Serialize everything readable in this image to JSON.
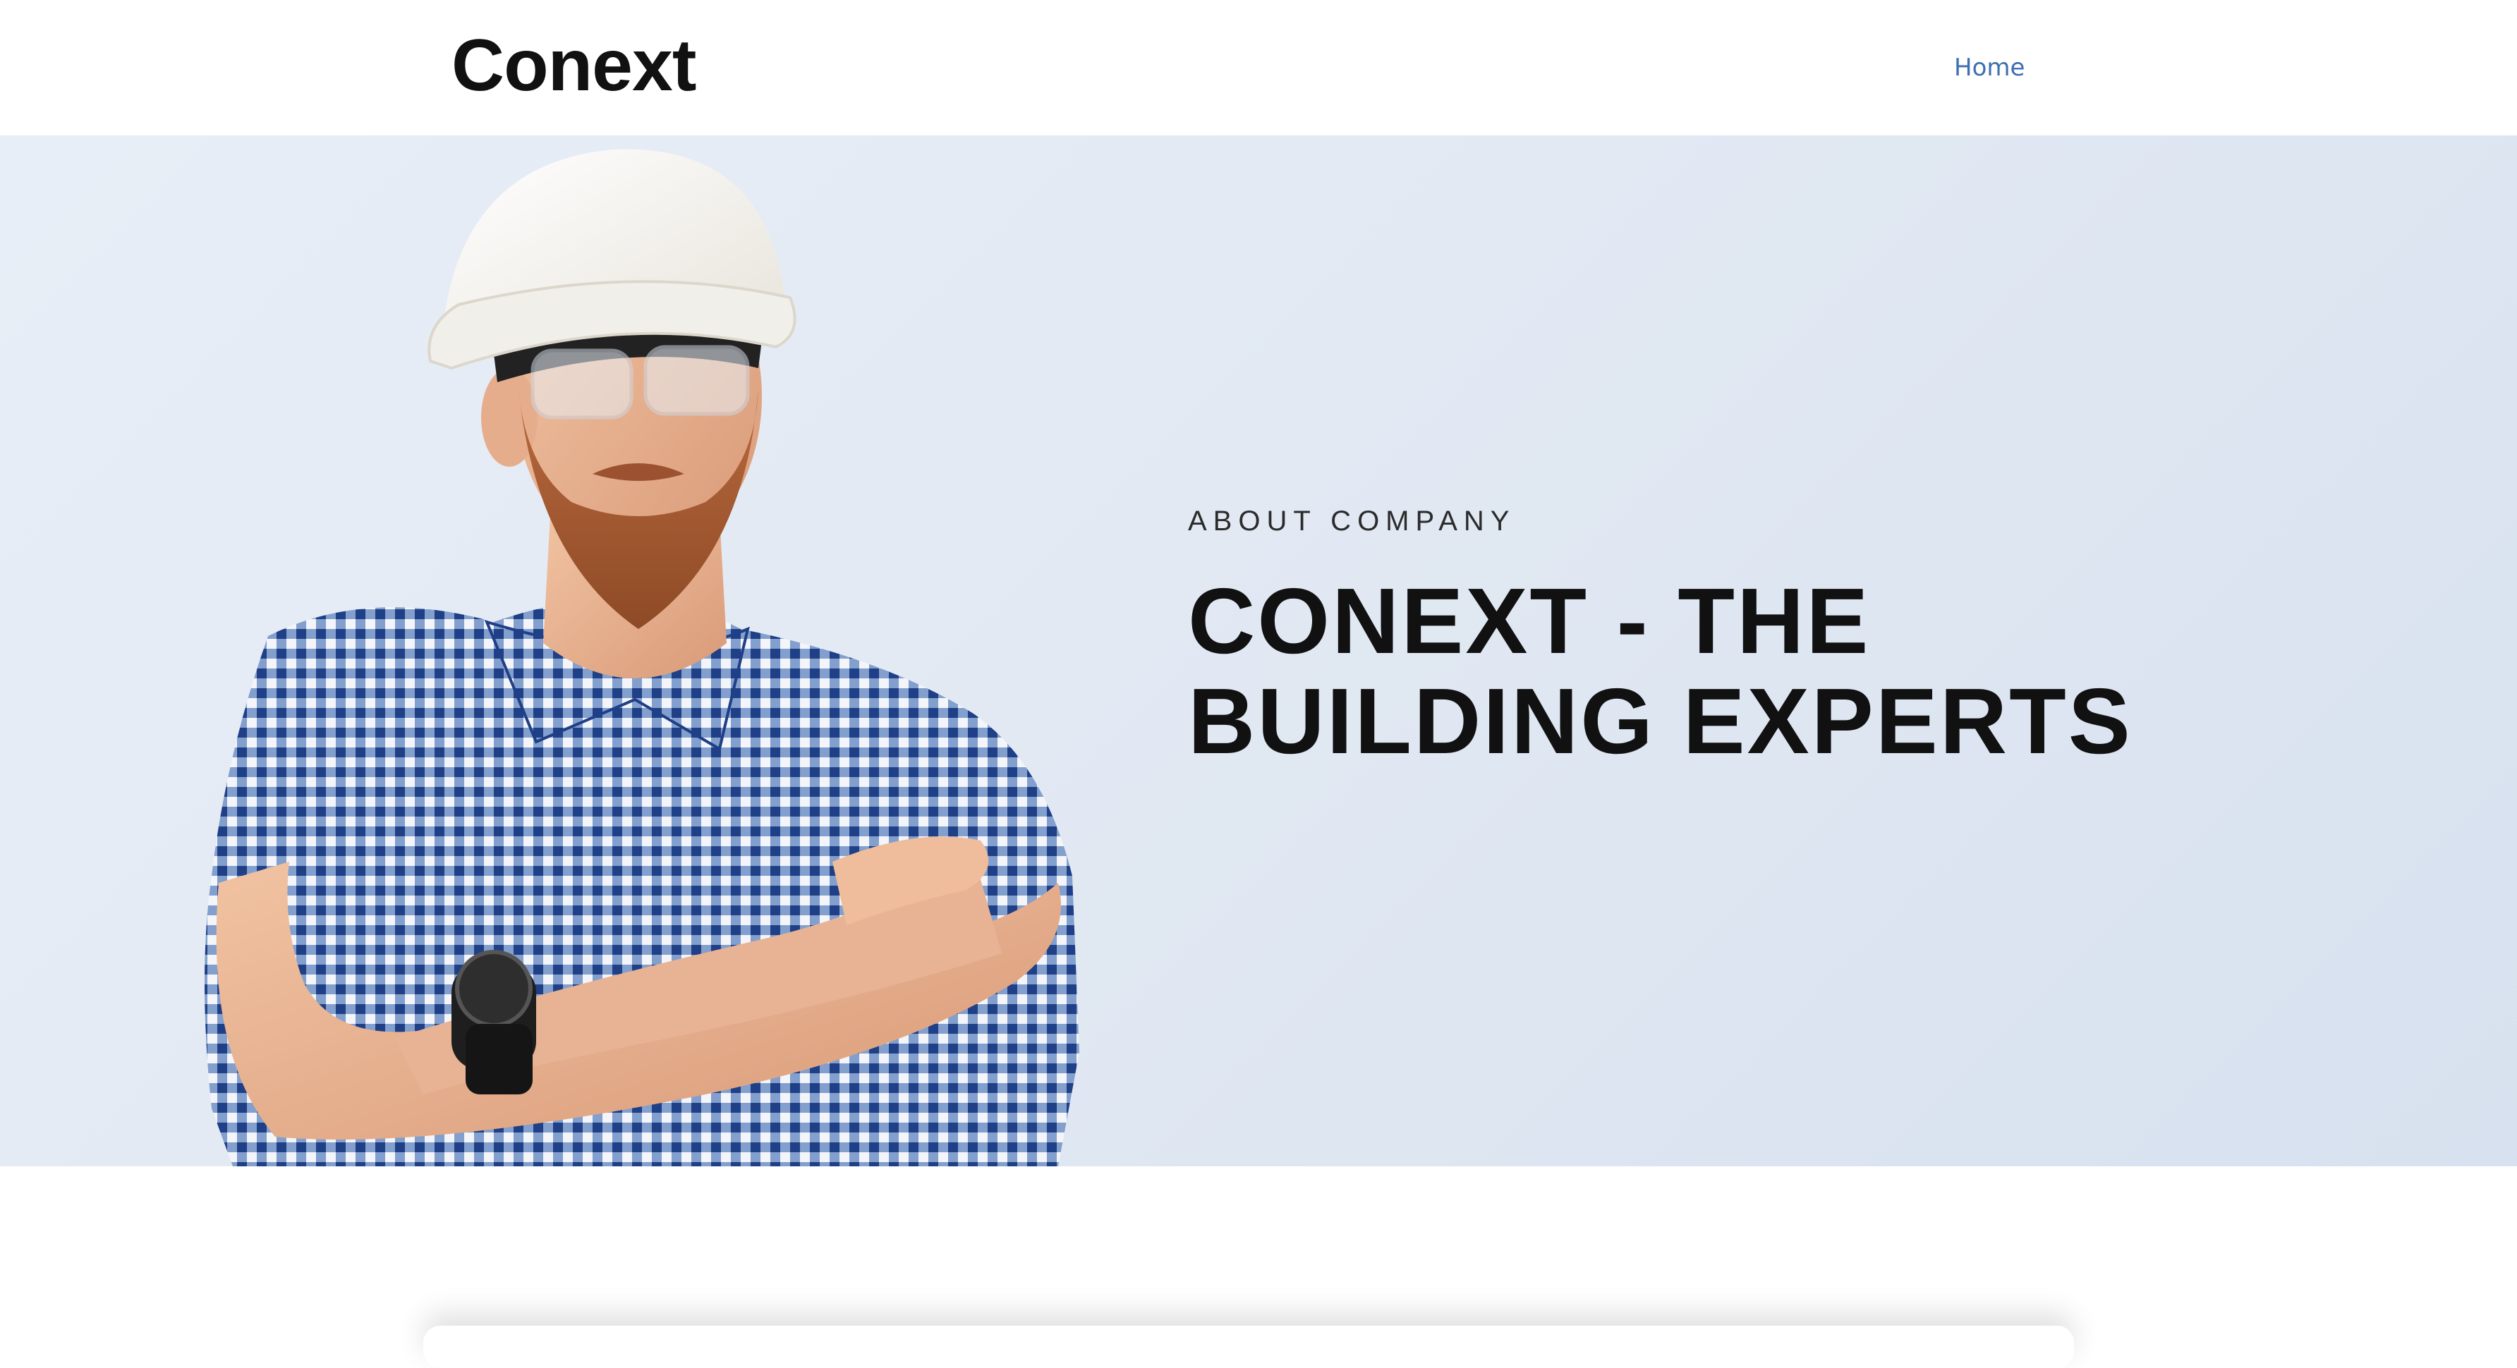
{
  "header": {
    "brand": "Conext",
    "nav": [
      {
        "label": "Home"
      }
    ]
  },
  "hero": {
    "eyebrow": "ABOUT COMPANY",
    "title_lines": [
      "CONEXT - THE",
      "BUILDING EXPERTS"
    ],
    "image_alt": "construction-worker-photo"
  },
  "colors": {
    "nav_link": "#3e6faf",
    "text_dark": "#111111",
    "hero_bg": "#e2e9f3",
    "page_bg": "#ffffff"
  }
}
